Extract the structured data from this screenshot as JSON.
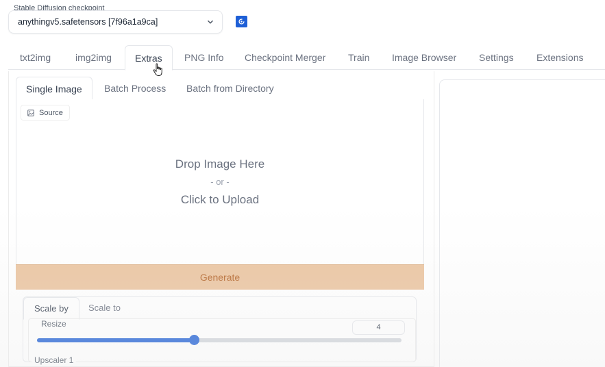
{
  "checkpoint": {
    "label": "Stable Diffusion checkpoint",
    "value": "anythingv5.safetensors [7f96a1a9ca]",
    "refresh_icon": "refresh-icon",
    "accent": "#1e5fd6"
  },
  "main_tabs": [
    {
      "label": "txt2img"
    },
    {
      "label": "img2img"
    },
    {
      "label": "Extras"
    },
    {
      "label": "PNG Info"
    },
    {
      "label": "Checkpoint Merger"
    },
    {
      "label": "Train"
    },
    {
      "label": "Image Browser"
    },
    {
      "label": "Settings"
    },
    {
      "label": "Extensions"
    }
  ],
  "active_main_tab": "Extras",
  "sub_tabs": [
    {
      "label": "Single Image"
    },
    {
      "label": "Batch Process"
    },
    {
      "label": "Batch from Directory"
    }
  ],
  "active_sub_tab": "Single Image",
  "upload": {
    "source_label": "Source",
    "drop_text": "Drop Image Here",
    "or_text": "- or -",
    "click_text": "Click to Upload"
  },
  "generate": {
    "label": "Generate",
    "color": "#ebc49f"
  },
  "scale": {
    "tabs": [
      {
        "label": "Scale by"
      },
      {
        "label": "Scale to"
      }
    ],
    "active_tab": "Scale by",
    "resize_label": "Resize",
    "resize_value": "4",
    "slider_fraction": 0.43,
    "upscaler_label": "Upscaler 1"
  }
}
